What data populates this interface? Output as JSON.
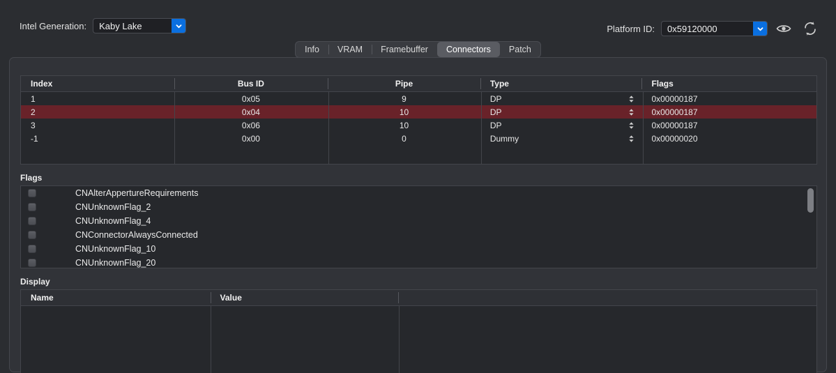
{
  "toolbar": {
    "generation_label": "Intel Generation:",
    "generation_value": "Kaby Lake",
    "platform_label": "Platform ID:",
    "platform_value": "0x59120000",
    "eye_icon": "eye-icon",
    "refresh_icon": "refresh-icon",
    "dropdown_icon": "chevron-down-icon"
  },
  "tabs": [
    {
      "label": "Info",
      "active": false
    },
    {
      "label": "VRAM",
      "active": false
    },
    {
      "label": "Framebuffer",
      "active": false
    },
    {
      "label": "Connectors",
      "active": true
    },
    {
      "label": "Patch",
      "active": false
    }
  ],
  "connectors": {
    "columns": [
      "Index",
      "Bus ID",
      "Pipe",
      "Type",
      "Flags"
    ],
    "rows": [
      {
        "index": "1",
        "bus_id": "0x05",
        "pipe": "9",
        "type": "DP",
        "flags": "0x00000187",
        "selected": false
      },
      {
        "index": "2",
        "bus_id": "0x04",
        "pipe": "10",
        "type": "DP",
        "flags": "0x00000187",
        "selected": true
      },
      {
        "index": "3",
        "bus_id": "0x06",
        "pipe": "10",
        "type": "DP",
        "flags": "0x00000187",
        "selected": false
      },
      {
        "index": "-1",
        "bus_id": "0x00",
        "pipe": "0",
        "type": "Dummy",
        "flags": "0x00000020",
        "selected": false
      }
    ]
  },
  "flags": {
    "section_label": "Flags",
    "items": [
      {
        "label": "CNAlterAppertureRequirements",
        "checked": false
      },
      {
        "label": "CNUnknownFlag_2",
        "checked": false
      },
      {
        "label": "CNUnknownFlag_4",
        "checked": false
      },
      {
        "label": "CNConnectorAlwaysConnected",
        "checked": false
      },
      {
        "label": "CNUnknownFlag_10",
        "checked": false
      },
      {
        "label": "CNUnknownFlag_20",
        "checked": false
      }
    ]
  },
  "display": {
    "section_label": "Display",
    "columns": [
      "Name",
      "Value",
      ""
    ],
    "rows": []
  },
  "colors": {
    "window_bg": "#2b2d31",
    "panel_bg": "#313338",
    "table_bg": "#26282c",
    "header_bg": "#2e3035",
    "selection": "#692229",
    "accent_blue": "#0a6fe0",
    "border": "#43454b"
  }
}
